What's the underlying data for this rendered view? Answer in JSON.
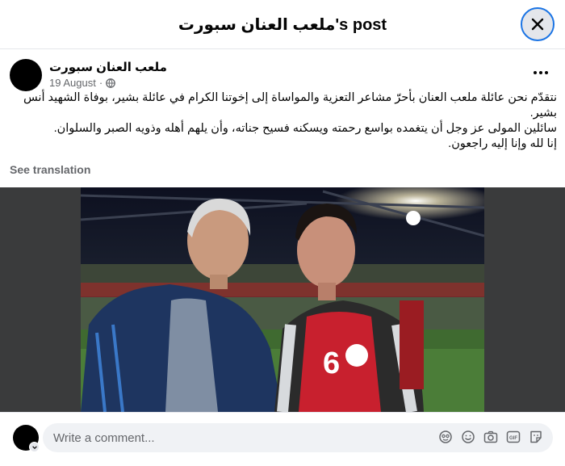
{
  "header": {
    "title": "ملعب العنان سبورت's post"
  },
  "post": {
    "author": "ملعب العنان سبورت",
    "date": "19 August",
    "separator": "·",
    "text_lines": [
      "نتقدّم نحن عائلة ملعب العنان بأحرّ مشاعر التعزية والمواساة إلى إخوتنا الكرام في عائلة بشير، بوفاة الشهيد أنس بشير.",
      "سائلين المولى عز وجل أن يتغمده بواسع رحمته ويسكنه فسيح جناته، وأن يلهم أهله وذويه الصبر والسلوان.",
      "إنا لله وإنا إليه راجعون."
    ],
    "see_translation": "See translation",
    "photo": {
      "jersey_number": "6"
    }
  },
  "comment": {
    "placeholder": "Write a comment..."
  },
  "icons": {
    "close": "close-icon",
    "globe": "globe-icon",
    "more": "more-icon",
    "avatar_sticker": "avatar-sticker-icon",
    "emoji": "emoji-icon",
    "camera": "camera-icon",
    "gif": "gif-icon",
    "sticker": "sticker-icon"
  },
  "colors": {
    "accent": "#1b74e4",
    "secondary_text": "#65676b",
    "input_bg": "#f0f2f5"
  }
}
